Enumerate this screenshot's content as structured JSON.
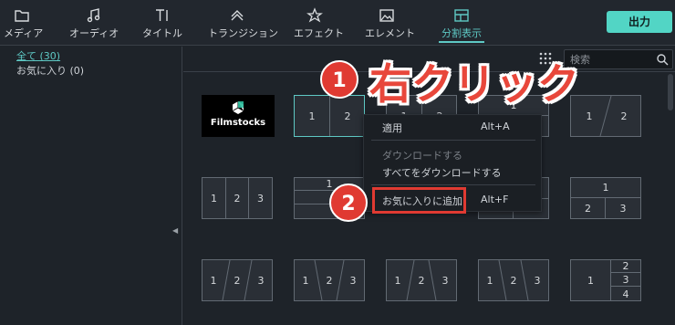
{
  "tabs": [
    {
      "label": "メディア",
      "icon": "folder-icon"
    },
    {
      "label": "オーディオ",
      "icon": "music-note-icon"
    },
    {
      "label": "タイトル",
      "icon": "title-text-icon"
    },
    {
      "label": "トランジション",
      "icon": "transition-icon"
    },
    {
      "label": "エフェクト",
      "icon": "effect-star-icon"
    },
    {
      "label": "エレメント",
      "icon": "image-element-icon"
    },
    {
      "label": "分割表示",
      "icon": "split-screen-icon"
    }
  ],
  "export_label": "出力",
  "sidebar": {
    "items": [
      {
        "label": "全て (30)"
      },
      {
        "label": "お気に入り (0)"
      }
    ]
  },
  "search": {
    "placeholder": "検索"
  },
  "tiles": [
    {
      "brand": "Filmstocks"
    },
    {
      "cells": [
        "1",
        "2"
      ]
    },
    {
      "cells": [
        "1",
        "2"
      ]
    },
    {
      "cells": [
        "1"
      ]
    },
    {
      "cells": [
        "1",
        "2"
      ]
    },
    {
      "cells": [
        "1",
        "2",
        "3"
      ]
    },
    {
      "cells": [
        "1"
      ]
    },
    {
      "cells": [
        "2",
        "3"
      ]
    },
    {
      "cells": [
        "2",
        "3"
      ]
    },
    {
      "cells": [
        "1",
        "2",
        "3"
      ]
    },
    {
      "cells": [
        "1",
        "2",
        "3"
      ]
    },
    {
      "cells": [
        "1",
        "2",
        "3"
      ]
    },
    {
      "cells": [
        "1",
        "2",
        "3"
      ]
    },
    {
      "cells": [
        "1",
        "2",
        "3"
      ]
    },
    {
      "cells": [
        "1",
        "2",
        "3",
        "4"
      ]
    }
  ],
  "context_menu": {
    "apply": "適用",
    "apply_shortcut": "Alt+A",
    "download": "ダウンロードする",
    "download_all": "すべてをダウンロードする",
    "add_favorite": "お気に入りに追加",
    "add_favorite_shortcut": "Alt+F"
  },
  "annotations": {
    "step1": "1",
    "step1_text": "右クリック",
    "step2": "2"
  },
  "colors": {
    "accent": "#5ec8c4",
    "export_bg": "#52d5c5",
    "annotation_red": "#e03a32"
  }
}
